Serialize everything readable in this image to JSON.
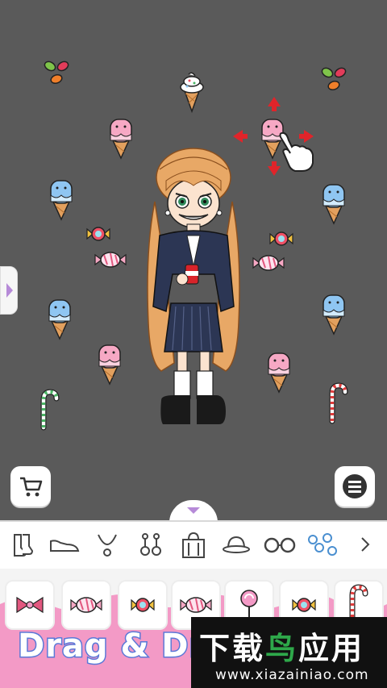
{
  "canvas": {
    "stickers": [
      {
        "type": "jelly-beans"
      },
      {
        "type": "soft-serve-cone"
      },
      {
        "type": "jelly-beans"
      },
      {
        "type": "pink-popsicle-cone"
      },
      {
        "type": "pink-popsicle-cone-selected"
      },
      {
        "type": "blue-popsicle-cone"
      },
      {
        "type": "blue-popsicle-cone"
      },
      {
        "type": "wrapped-candy-yellow"
      },
      {
        "type": "wrapped-candy-yellow"
      },
      {
        "type": "wrapped-candy-pink"
      },
      {
        "type": "wrapped-candy-pink"
      },
      {
        "type": "blue-popsicle-cone"
      },
      {
        "type": "blue-popsicle-cone"
      },
      {
        "type": "pink-popsicle-cone"
      },
      {
        "type": "pink-popsicle-cone"
      },
      {
        "type": "candy-cane-green"
      },
      {
        "type": "candy-cane-red"
      }
    ],
    "character": "girl-in-school-uniform"
  },
  "buttons": {
    "cart_icon": "cart-icon",
    "menu_icon": "hamburger-menu-icon",
    "collapse_icon": "chevron-down-icon",
    "side_icon": "chevron-right-icon"
  },
  "categories": [
    {
      "name": "socks-icon"
    },
    {
      "name": "shoes-icon"
    },
    {
      "name": "necklace-icon"
    },
    {
      "name": "earrings-icon"
    },
    {
      "name": "bag-icon"
    },
    {
      "name": "hat-icon"
    },
    {
      "name": "glasses-icon"
    },
    {
      "name": "candy-stickers-icon",
      "active": true
    },
    {
      "name": "more-icon"
    }
  ],
  "items": [
    {
      "name": "ribbon-icon"
    },
    {
      "name": "candy-icon"
    },
    {
      "name": "candy-icon"
    },
    {
      "name": "candy-icon"
    },
    {
      "name": "lollipop-icon"
    },
    {
      "name": "candy-icon"
    },
    {
      "name": "candy-cane-icon"
    }
  ],
  "banner": {
    "text": "Drag & Dro"
  },
  "watermark": {
    "brand_a": "下载",
    "brand_b": "鸟",
    "brand_c": "应用",
    "url": "www.xiazainiao.com"
  },
  "colors": {
    "accent_purple": "#b68ad8",
    "banner_pink": "#f39ac6",
    "stage_gray": "#5a5a5a",
    "watermark_green": "#2ea84a"
  }
}
